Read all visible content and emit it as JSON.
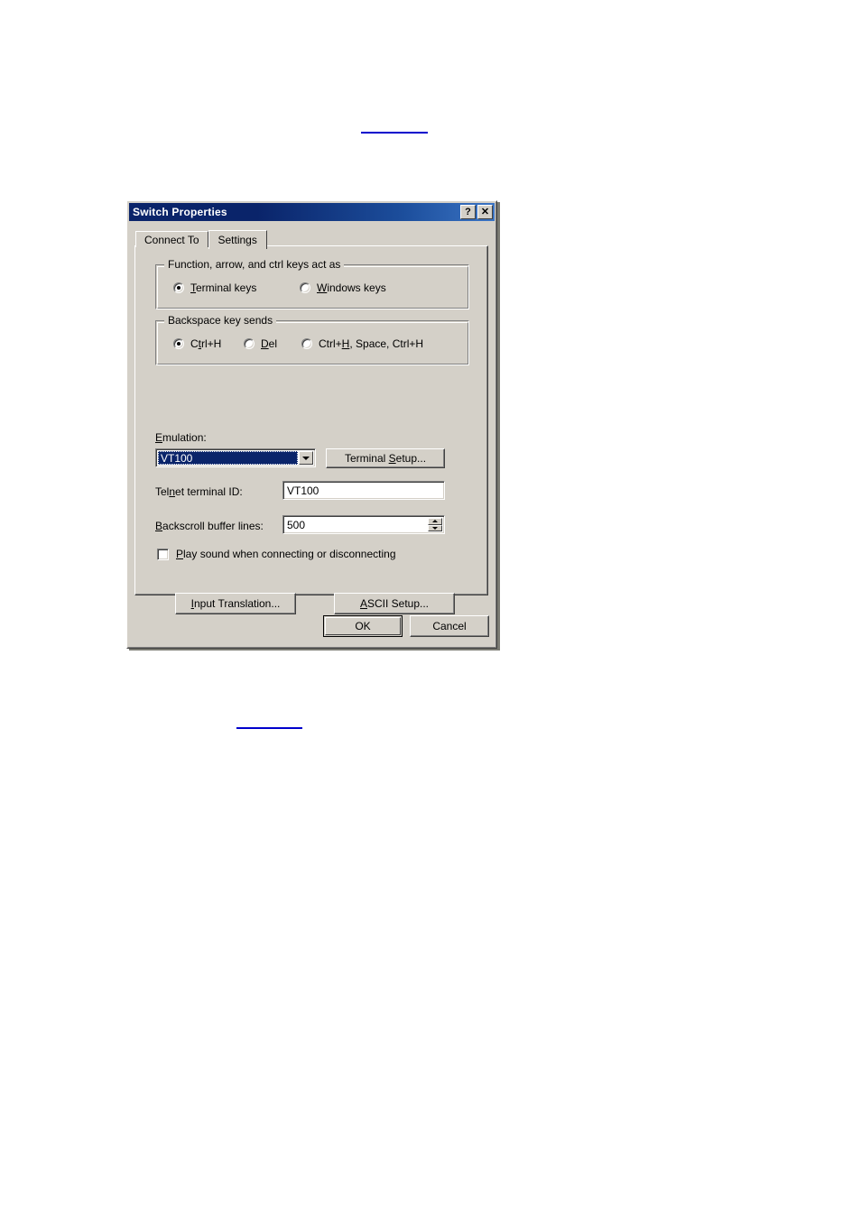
{
  "page": {
    "links": [
      {
        "name": "top-anchor-link",
        "text": ""
      },
      {
        "name": "bottom-anchor-link",
        "text": ""
      }
    ]
  },
  "dialog": {
    "title": "Switch Properties",
    "titlebar_buttons": {
      "help": "?",
      "close": "✕"
    },
    "tabs": [
      {
        "label": "Connect To",
        "active": false
      },
      {
        "label": "Settings",
        "active": true
      }
    ],
    "groups": {
      "function_keys": {
        "title": "Function, arrow, and ctrl keys act as",
        "options": [
          {
            "label_pre": "",
            "accel": "T",
            "label_post": "erminal keys",
            "selected": true
          },
          {
            "label_pre": "",
            "accel": "W",
            "label_post": "indows keys",
            "selected": false
          }
        ]
      },
      "backspace": {
        "title": "Backspace key sends",
        "options": [
          {
            "label_pre": "C",
            "accel": "t",
            "label_post": "rl+H",
            "selected": true
          },
          {
            "label_pre": "",
            "accel": "D",
            "label_post": "el",
            "selected": false
          },
          {
            "label_pre": "Ctrl+",
            "accel": "H",
            "label_post": ", Space, Ctrl+H",
            "selected": false
          }
        ]
      }
    },
    "emulation": {
      "label_pre": "",
      "label_accel": "E",
      "label_post": "mulation:",
      "value": "VT100",
      "terminal_setup_button": {
        "pre": "Terminal ",
        "accel": "S",
        "post": "etup..."
      }
    },
    "telnet_terminal_id": {
      "label_pre": "Tel",
      "label_accel": "n",
      "label_post": "et terminal ID:",
      "value": "VT100"
    },
    "backscroll_buffer_lines": {
      "label_pre": "",
      "label_accel": "B",
      "label_post": "ackscroll buffer lines:",
      "value": "500"
    },
    "play_sound": {
      "label_pre": "",
      "label_accel": "P",
      "label_post": "lay sound when connecting or disconnecting",
      "checked": false
    },
    "buttons": {
      "input_translation": {
        "pre": "",
        "accel": "I",
        "post": "nput Translation..."
      },
      "ascii_setup": {
        "pre": "",
        "accel": "A",
        "post": "SCII Setup..."
      },
      "ok": "OK",
      "cancel": "Cancel"
    }
  },
  "colors": {
    "titlebar_start": "#0a246a",
    "titlebar_end": "#3b74c4",
    "dialog_face": "#d4d0c8",
    "selection": "#0a246a",
    "link": "#0000cc"
  }
}
